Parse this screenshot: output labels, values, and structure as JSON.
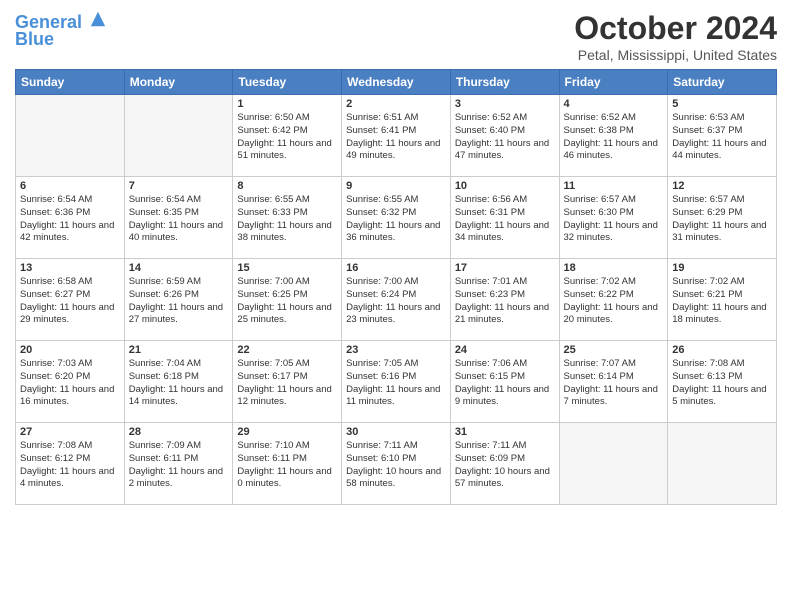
{
  "header": {
    "logo_line1": "General",
    "logo_line2": "Blue",
    "month_title": "October 2024",
    "location": "Petal, Mississippi, United States"
  },
  "days_of_week": [
    "Sunday",
    "Monday",
    "Tuesday",
    "Wednesday",
    "Thursday",
    "Friday",
    "Saturday"
  ],
  "weeks": [
    [
      {
        "day": "",
        "empty": true
      },
      {
        "day": "",
        "empty": true
      },
      {
        "day": "1",
        "detail": "Sunrise: 6:50 AM\nSunset: 6:42 PM\nDaylight: 11 hours and 51 minutes."
      },
      {
        "day": "2",
        "detail": "Sunrise: 6:51 AM\nSunset: 6:41 PM\nDaylight: 11 hours and 49 minutes."
      },
      {
        "day": "3",
        "detail": "Sunrise: 6:52 AM\nSunset: 6:40 PM\nDaylight: 11 hours and 47 minutes."
      },
      {
        "day": "4",
        "detail": "Sunrise: 6:52 AM\nSunset: 6:38 PM\nDaylight: 11 hours and 46 minutes."
      },
      {
        "day": "5",
        "detail": "Sunrise: 6:53 AM\nSunset: 6:37 PM\nDaylight: 11 hours and 44 minutes."
      }
    ],
    [
      {
        "day": "6",
        "detail": "Sunrise: 6:54 AM\nSunset: 6:36 PM\nDaylight: 11 hours and 42 minutes."
      },
      {
        "day": "7",
        "detail": "Sunrise: 6:54 AM\nSunset: 6:35 PM\nDaylight: 11 hours and 40 minutes."
      },
      {
        "day": "8",
        "detail": "Sunrise: 6:55 AM\nSunset: 6:33 PM\nDaylight: 11 hours and 38 minutes."
      },
      {
        "day": "9",
        "detail": "Sunrise: 6:55 AM\nSunset: 6:32 PM\nDaylight: 11 hours and 36 minutes."
      },
      {
        "day": "10",
        "detail": "Sunrise: 6:56 AM\nSunset: 6:31 PM\nDaylight: 11 hours and 34 minutes."
      },
      {
        "day": "11",
        "detail": "Sunrise: 6:57 AM\nSunset: 6:30 PM\nDaylight: 11 hours and 32 minutes."
      },
      {
        "day": "12",
        "detail": "Sunrise: 6:57 AM\nSunset: 6:29 PM\nDaylight: 11 hours and 31 minutes."
      }
    ],
    [
      {
        "day": "13",
        "detail": "Sunrise: 6:58 AM\nSunset: 6:27 PM\nDaylight: 11 hours and 29 minutes."
      },
      {
        "day": "14",
        "detail": "Sunrise: 6:59 AM\nSunset: 6:26 PM\nDaylight: 11 hours and 27 minutes."
      },
      {
        "day": "15",
        "detail": "Sunrise: 7:00 AM\nSunset: 6:25 PM\nDaylight: 11 hours and 25 minutes."
      },
      {
        "day": "16",
        "detail": "Sunrise: 7:00 AM\nSunset: 6:24 PM\nDaylight: 11 hours and 23 minutes."
      },
      {
        "day": "17",
        "detail": "Sunrise: 7:01 AM\nSunset: 6:23 PM\nDaylight: 11 hours and 21 minutes."
      },
      {
        "day": "18",
        "detail": "Sunrise: 7:02 AM\nSunset: 6:22 PM\nDaylight: 11 hours and 20 minutes."
      },
      {
        "day": "19",
        "detail": "Sunrise: 7:02 AM\nSunset: 6:21 PM\nDaylight: 11 hours and 18 minutes."
      }
    ],
    [
      {
        "day": "20",
        "detail": "Sunrise: 7:03 AM\nSunset: 6:20 PM\nDaylight: 11 hours and 16 minutes."
      },
      {
        "day": "21",
        "detail": "Sunrise: 7:04 AM\nSunset: 6:18 PM\nDaylight: 11 hours and 14 minutes."
      },
      {
        "day": "22",
        "detail": "Sunrise: 7:05 AM\nSunset: 6:17 PM\nDaylight: 11 hours and 12 minutes."
      },
      {
        "day": "23",
        "detail": "Sunrise: 7:05 AM\nSunset: 6:16 PM\nDaylight: 11 hours and 11 minutes."
      },
      {
        "day": "24",
        "detail": "Sunrise: 7:06 AM\nSunset: 6:15 PM\nDaylight: 11 hours and 9 minutes."
      },
      {
        "day": "25",
        "detail": "Sunrise: 7:07 AM\nSunset: 6:14 PM\nDaylight: 11 hours and 7 minutes."
      },
      {
        "day": "26",
        "detail": "Sunrise: 7:08 AM\nSunset: 6:13 PM\nDaylight: 11 hours and 5 minutes."
      }
    ],
    [
      {
        "day": "27",
        "detail": "Sunrise: 7:08 AM\nSunset: 6:12 PM\nDaylight: 11 hours and 4 minutes."
      },
      {
        "day": "28",
        "detail": "Sunrise: 7:09 AM\nSunset: 6:11 PM\nDaylight: 11 hours and 2 minutes."
      },
      {
        "day": "29",
        "detail": "Sunrise: 7:10 AM\nSunset: 6:11 PM\nDaylight: 11 hours and 0 minutes."
      },
      {
        "day": "30",
        "detail": "Sunrise: 7:11 AM\nSunset: 6:10 PM\nDaylight: 10 hours and 58 minutes."
      },
      {
        "day": "31",
        "detail": "Sunrise: 7:11 AM\nSunset: 6:09 PM\nDaylight: 10 hours and 57 minutes."
      },
      {
        "day": "",
        "empty": true
      },
      {
        "day": "",
        "empty": true
      }
    ]
  ]
}
